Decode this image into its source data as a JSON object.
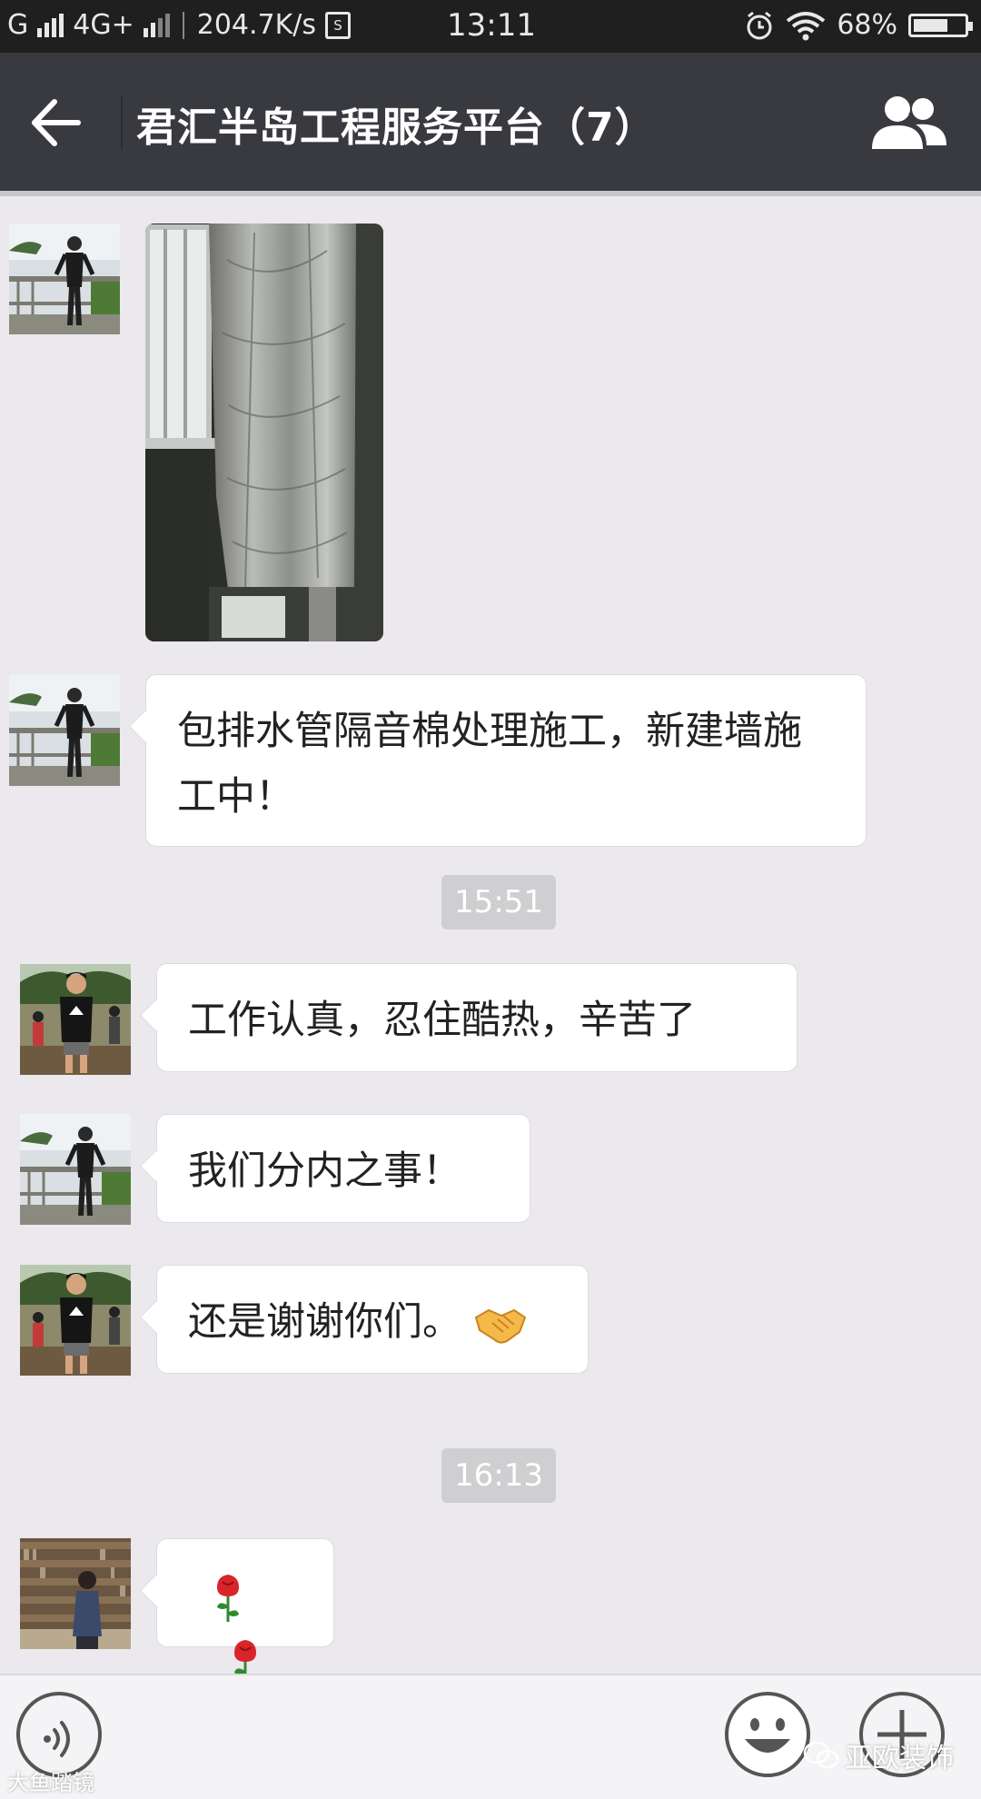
{
  "status_bar": {
    "carrier_left": "G",
    "network": "4G+",
    "speed": "204.7K/s",
    "sim_badge": "S",
    "time": "13:11",
    "battery": "68%",
    "battery_level": 0.68
  },
  "header": {
    "title": "君汇半岛工程服务平台（7）",
    "back_icon": "back-arrow-icon",
    "members_icon": "group-members-icon"
  },
  "messages": {
    "m1": {
      "type": "image",
      "content": "photo of pipe wrapped in foil insulation"
    },
    "m2": {
      "text": "包排水管隔音棉处理施工，新建墙施工中！"
    },
    "t1": "15:51",
    "m3": {
      "text": "工作认真，忍住酷热，辛苦了"
    },
    "m4": {
      "text": "我们分内之事！"
    },
    "m5": {
      "text": "还是谢谢你们。",
      "emoji": "handshake-icon"
    },
    "t2": "16:13",
    "m6": {
      "emoji": "rose-icon"
    }
  },
  "input_bar": {
    "voice_icon": "voice-icon",
    "emoji_icon": "smiley-icon",
    "plus_icon": "plus-icon"
  },
  "watermarks": {
    "right": "亚欧装饰",
    "left": "大鱼踏镜"
  },
  "colors": {
    "titlebar": "#393a3f",
    "chat_bg": "#ebe9ee",
    "bubble": "#ffffff",
    "time_chip": "#cfcfd2"
  }
}
